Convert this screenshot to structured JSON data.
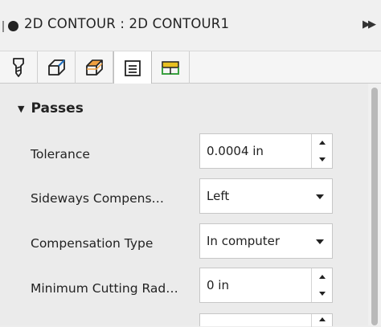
{
  "window": {
    "title": "2D CONTOUR : 2D CONTOUR1",
    "collapse_icon": "double-chevron-right-icon"
  },
  "tabs": [
    {
      "name": "tool",
      "icon": "tool-icon",
      "active": false
    },
    {
      "name": "geometry",
      "icon": "geometry-icon",
      "active": false
    },
    {
      "name": "heights",
      "icon": "heights-icon",
      "active": false
    },
    {
      "name": "passes",
      "icon": "passes-icon",
      "active": true
    },
    {
      "name": "linking",
      "icon": "linking-icon",
      "active": false
    }
  ],
  "section": {
    "title": "Passes",
    "expanded": true
  },
  "fields": {
    "tolerance": {
      "label": "Tolerance",
      "value": "0.0004 in"
    },
    "sideways_compensation": {
      "label": "Sideways Compens…",
      "value": "Left"
    },
    "compensation_type": {
      "label": "Compensation Type",
      "value": "In computer"
    },
    "min_cutting_radius": {
      "label": "Minimum Cutting Rad…",
      "value": "0 in"
    }
  },
  "colors": {
    "accent_orange": "#f0a040",
    "accent_blue": "#1e6fbf",
    "accent_green": "#3aa040",
    "accent_yellow": "#e8c020"
  }
}
